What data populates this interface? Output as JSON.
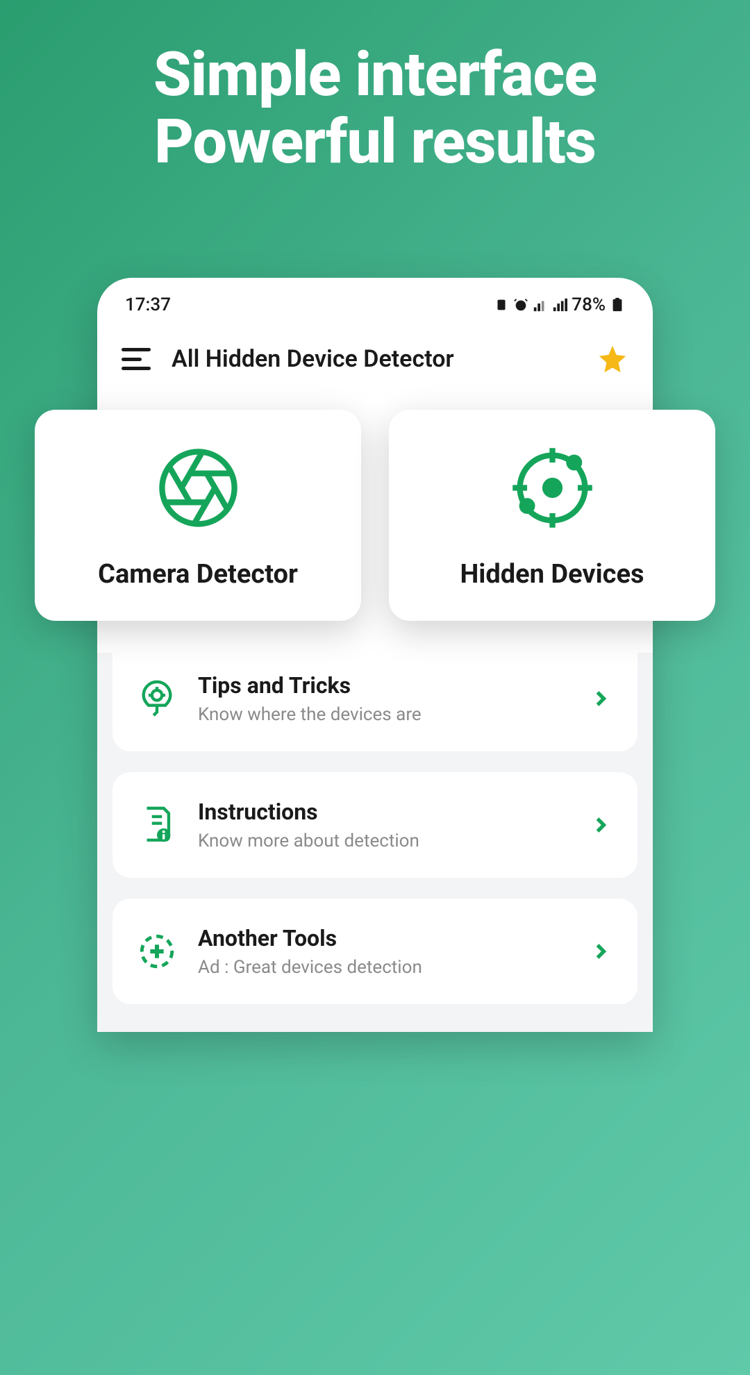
{
  "hero": {
    "line1": "Simple interface",
    "line2": "Powerful results"
  },
  "statusBar": {
    "time": "17:37",
    "battery": "78%"
  },
  "header": {
    "title": "All Hidden Device Detector"
  },
  "mainCards": [
    {
      "label": "Camera Detector",
      "icon": "aperture"
    },
    {
      "label": "Hidden Devices",
      "icon": "radar"
    }
  ],
  "listItems": [
    {
      "title": "Tips and Tricks",
      "subtitle": "Know where the devices are",
      "icon": "bulb"
    },
    {
      "title": "Instructions",
      "subtitle": "Know more about detection",
      "icon": "doc"
    },
    {
      "title": "Another Tools",
      "subtitle": "Ad : Great devices detection",
      "icon": "plus"
    }
  ],
  "colors": {
    "accent": "#15a55a",
    "text": "#1a1a1a",
    "muted": "#8a8a8a"
  }
}
